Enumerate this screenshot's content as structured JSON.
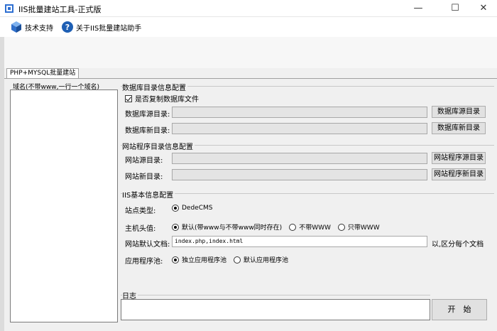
{
  "window": {
    "title": "IIS批量建站工具-正式版",
    "minimize_glyph": "—",
    "maximize_glyph": "☐",
    "close_glyph": "✕"
  },
  "toolbar": {
    "tech_support_label": "技术支持",
    "about_label": "关于IIS批量建站助手"
  },
  "tabs": {
    "main_tab": "PHP+MYSQL批量建站"
  },
  "domains": {
    "label": "域名(不带www,一行一个域名)"
  },
  "db": {
    "group_title": "数据库目录信息配置",
    "copy_checkbox_label": "是否复制数据库文件",
    "source_label": "数据库源目录:",
    "source_button": "数据库源目录",
    "new_label": "数据库新目录:",
    "new_button": "数据库新目录"
  },
  "site": {
    "group_title": "网站程序目录信息配置",
    "source_label": "网站源目录:",
    "source_button": "网站程序源目录",
    "new_label": "网站新目录:",
    "new_button": "网站程序新目录"
  },
  "iis": {
    "group_title": "IIS基本信息配置",
    "site_type_label": "站点类型:",
    "site_type_option": "DedeCMS",
    "host_label": "主机头值:",
    "host_opt_default": "默认(带www与不带www同时存在)",
    "host_opt_no_www": "不带WWW",
    "host_opt_www_only": "只带WWW",
    "default_doc_label": "网站默认文档:",
    "default_doc_value": "index.php,index.html",
    "default_doc_hint": "以,区分每个文档",
    "app_pool_label": "应用程序池:",
    "pool_opt_independent": "独立应用程序池",
    "pool_opt_default": "默认应用程序池"
  },
  "log": {
    "label": "日志",
    "start_button": "开　始"
  },
  "colors": {
    "accent": "#1e5fb4"
  }
}
